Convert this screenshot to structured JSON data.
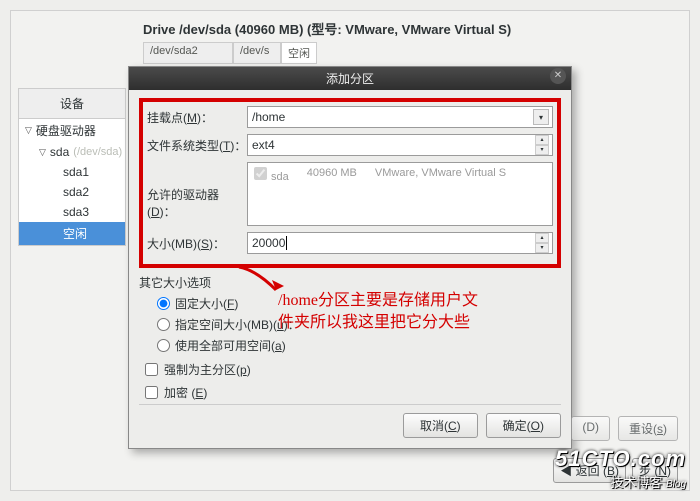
{
  "drive": {
    "title": "Drive /dev/sda (40960 MB) (型号: VMware, VMware Virtual S)",
    "col1": "/dev/sda2",
    "col2": "/dev/s",
    "col3": "空闲"
  },
  "sidebar": {
    "header": "设备",
    "root": "硬盘驱动器",
    "disk": "sda",
    "disk_dim": "(/dev/sda)",
    "p1": "sda1",
    "p2": "sda2",
    "p3": "sda3",
    "free": "空闲"
  },
  "dialog": {
    "title": "添加分区",
    "mount_label": "挂载点(M)：",
    "mount_value": "/home",
    "fs_label": "文件系统类型(T)：",
    "fs_value": "ext4",
    "allow_label": "允许的驱动器(D)：",
    "drv_name": "sda",
    "drv_size": "40960 MB",
    "drv_model": "VMware, VMware Virtual S",
    "size_label": "大小(MB)(S)：",
    "size_value": "20000",
    "group": "其它大小选项",
    "r1": "固定大小(F)",
    "r2": "指定空间大小(MB)(u)：",
    "r3": "使用全部可用空间(a)",
    "c1": "强制为主分区(p)",
    "c2": "加密 (E)",
    "cancel": "取消(C)",
    "ok": "确定(O)"
  },
  "callout": "/home分区主要是存储用户文件夹所以我这里把它分大些",
  "outside": {
    "d": "(D)",
    "reset": "重设(s)"
  },
  "bottom": {
    "back": "返回 (B)",
    "next": "步 (N)"
  },
  "watermark": {
    "big": "51CTO.com",
    "small": "技术博客",
    "blog": "Blog"
  }
}
